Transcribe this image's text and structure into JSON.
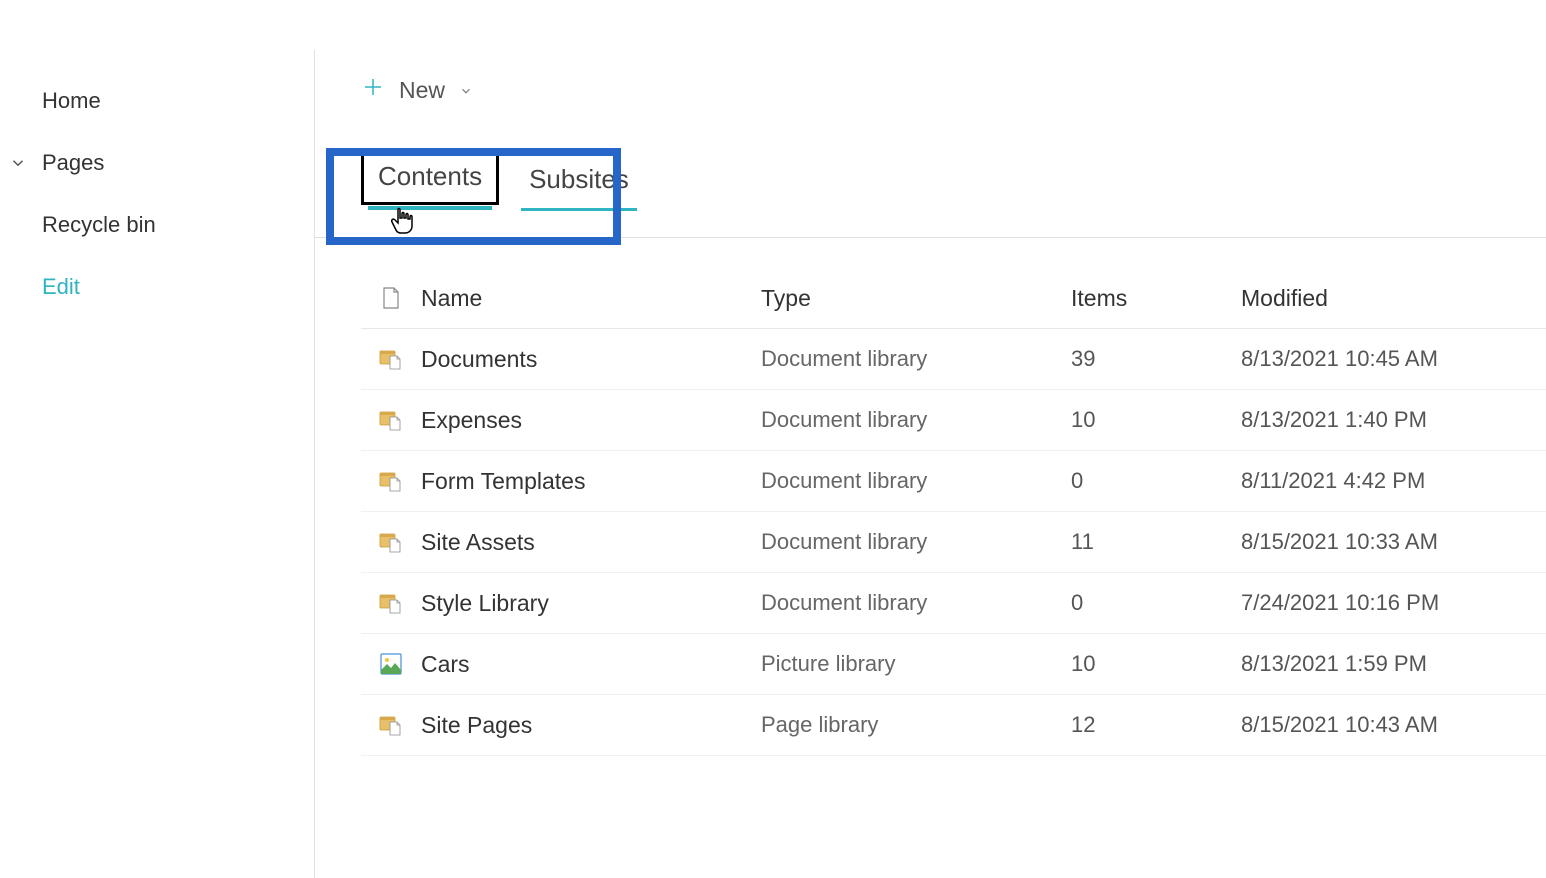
{
  "sidebar": {
    "items": [
      {
        "label": "Home",
        "expandable": false
      },
      {
        "label": "Pages",
        "expandable": true
      },
      {
        "label": "Recycle bin",
        "expandable": false
      }
    ],
    "edit_label": "Edit"
  },
  "toolbar": {
    "new_label": "New"
  },
  "tabs": {
    "contents": "Contents",
    "subsites": "Subsites"
  },
  "table": {
    "headers": {
      "name": "Name",
      "type": "Type",
      "items": "Items",
      "modified": "Modified"
    },
    "rows": [
      {
        "icon": "doclib",
        "name": "Documents",
        "type": "Document library",
        "items": "39",
        "modified": "8/13/2021 10:45 AM"
      },
      {
        "icon": "doclib",
        "name": "Expenses",
        "type": "Document library",
        "items": "10",
        "modified": "8/13/2021 1:40 PM"
      },
      {
        "icon": "doclib",
        "name": "Form Templates",
        "type": "Document library",
        "items": "0",
        "modified": "8/11/2021 4:42 PM"
      },
      {
        "icon": "doclib",
        "name": "Site Assets",
        "type": "Document library",
        "items": "11",
        "modified": "8/15/2021 10:33 AM"
      },
      {
        "icon": "doclib",
        "name": "Style Library",
        "type": "Document library",
        "items": "0",
        "modified": "7/24/2021 10:16 PM"
      },
      {
        "icon": "piclib",
        "name": "Cars",
        "type": "Picture library",
        "items": "10",
        "modified": "8/13/2021 1:59 PM"
      },
      {
        "icon": "doclib",
        "name": "Site Pages",
        "type": "Page library",
        "items": "12",
        "modified": "8/15/2021 10:43 AM"
      }
    ]
  }
}
